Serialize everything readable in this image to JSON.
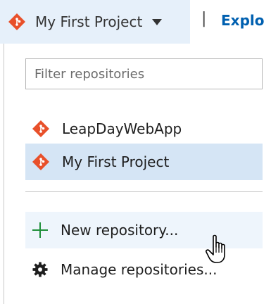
{
  "header": {
    "project_name": "My First Project",
    "separator": "|",
    "explore_label": "Explo"
  },
  "filter": {
    "placeholder": "Filter repositories",
    "value": ""
  },
  "repositories": [
    {
      "name": "LeapDayWebApp",
      "selected": false
    },
    {
      "name": "My First Project",
      "selected": true
    }
  ],
  "actions": {
    "new_repository": "New repository...",
    "manage_repositories": "Manage repositories..."
  },
  "colors": {
    "git_orange": "#e8502a",
    "selection": "#d5e5f5",
    "header_bg": "#e6f0fa",
    "link_blue": "#0060b0",
    "plus_green": "#1f8f3a"
  },
  "icons": {
    "repo_icon": "git-diamond-icon",
    "new_icon": "plus-icon",
    "manage_icon": "gear-icon",
    "dropdown_icon": "caret-down-icon",
    "pointer": "hand-cursor-icon"
  }
}
